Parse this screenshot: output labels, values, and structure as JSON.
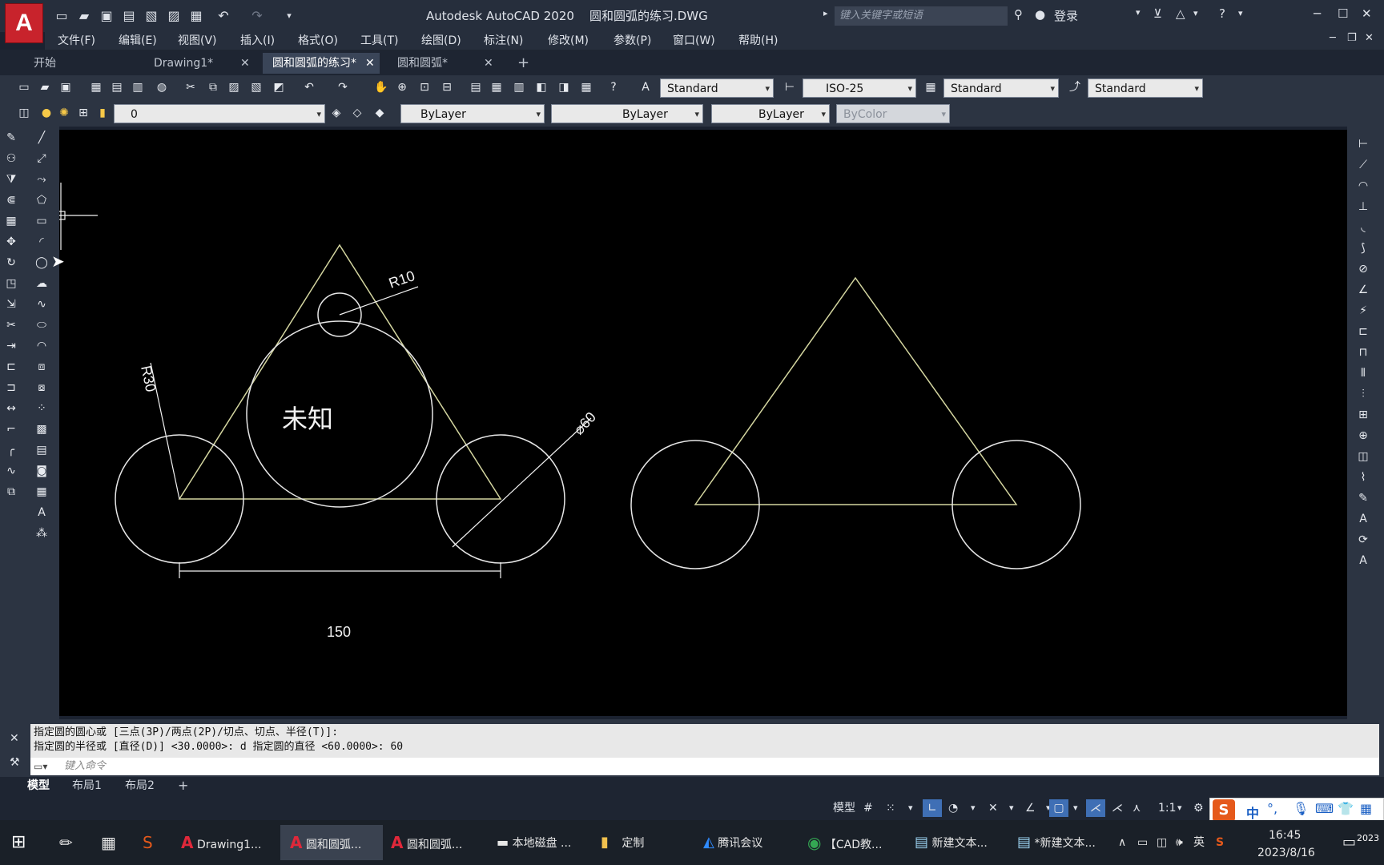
{
  "app": {
    "title": "Autodesk AutoCAD 2020    圆和圆弧的练习.DWG",
    "logo": "A",
    "search_placeholder": "键入关键字或短语",
    "login_label": "登录"
  },
  "menubar": [
    "文件(F)",
    "编辑(E)",
    "视图(V)",
    "插入(I)",
    "格式(O)",
    "工具(T)",
    "绘图(D)",
    "标注(N)",
    "修改(M)",
    "参数(P)",
    "窗口(W)",
    "帮助(H)"
  ],
  "doc_tabs": [
    {
      "label": "开始",
      "close": ""
    },
    {
      "label": "Drawing1*",
      "close": "✕"
    },
    {
      "label": "圆和圆弧的练习*",
      "close": "✕",
      "active": true
    },
    {
      "label": "圆和圆弧*",
      "close": "✕"
    }
  ],
  "ribbon": {
    "text_style": "Standard",
    "dim_style": "ISO-25",
    "table_style": "Standard",
    "mleader_style": "Standard",
    "layer": "0",
    "color": "ByLayer",
    "linetype": "ByLayer",
    "lineweight": "ByLayer",
    "plotstyle": "ByColor"
  },
  "drawing": {
    "dims": {
      "r10": "R10",
      "r30": "R30",
      "d60": "⌀60",
      "len150": "150"
    },
    "unknown_label": "未知",
    "colors": {
      "geometry": "#d6d9a8",
      "circles": "#e8e8e8",
      "dims": "#ffffff"
    }
  },
  "command": {
    "line1": "指定圆的圆心或 [三点(3P)/两点(2P)/切点、切点、半径(T)]:",
    "line2": "指定圆的半径或 [直径(D)] <30.0000>: d 指定圆的直径 <60.0000>: 60",
    "input_placeholder": "键入命令"
  },
  "layout_tabs": [
    "模型",
    "布局1",
    "布局2",
    "+"
  ],
  "status": {
    "model": "模型",
    "scale": "1:1"
  },
  "ime": {
    "lang": "中",
    "mode": "英"
  },
  "taskbar": {
    "items": [
      {
        "label": "Drawing1..."
      },
      {
        "label": "圆和圆弧...",
        "active": true
      },
      {
        "label": "圆和圆弧..."
      },
      {
        "label": "本地磁盘 ..."
      },
      {
        "label": "定制"
      },
      {
        "label": "腾讯会议"
      },
      {
        "label": "【CAD教..."
      },
      {
        "label": "新建文本..."
      },
      {
        "label": "*新建文本..."
      }
    ],
    "time": "16:45",
    "date": "2023/8/16",
    "lang": "英",
    "year_badge": "2023"
  }
}
